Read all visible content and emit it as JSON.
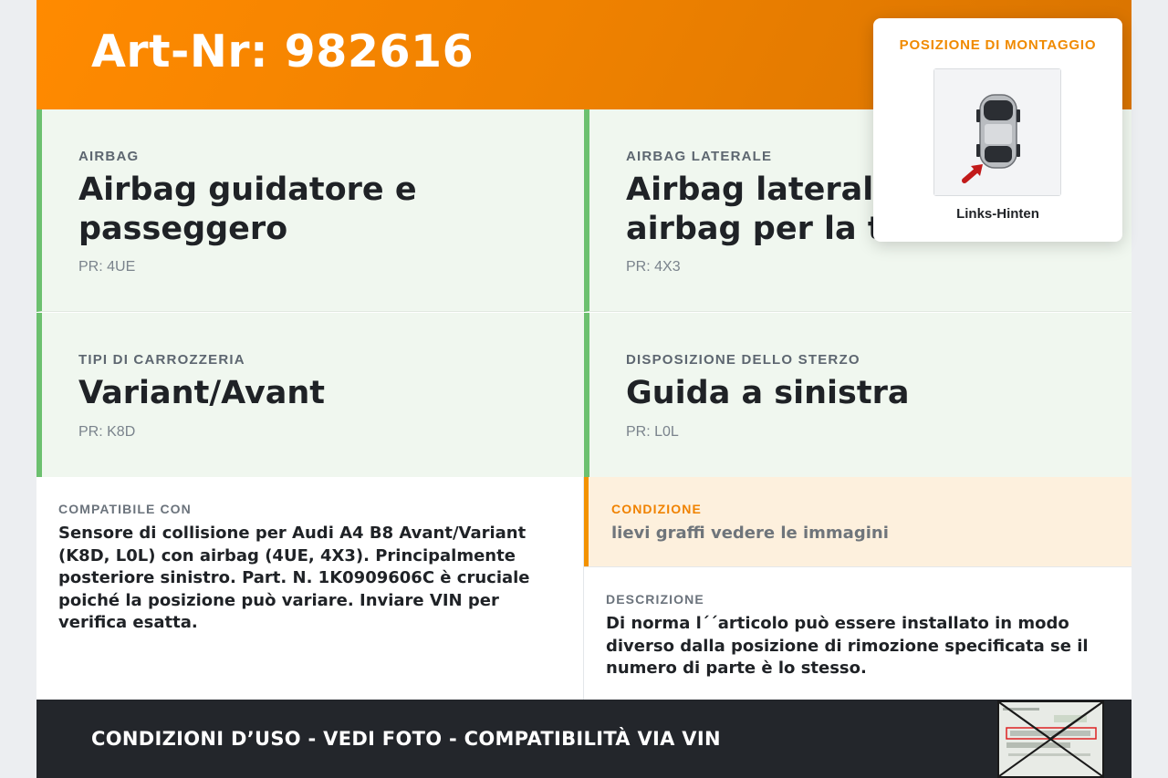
{
  "header": {
    "art_nr": "Art-Nr: 982616"
  },
  "cards": [
    {
      "label": "AIRBAG",
      "value": "Airbag guidatore e passeggero",
      "pr": "PR: 4UE"
    },
    {
      "label": "AIRBAG LATERALE",
      "value": "Airbag laterale anteriore e airbag per la testa",
      "pr": "PR: 4X3"
    },
    {
      "label": "TIPI DI CARROZZERIA",
      "value": "Variant/Avant",
      "pr": "PR: K8D"
    },
    {
      "label": "DISPOSIZIONE DELLO STERZO",
      "value": "Guida a sinistra",
      "pr": "PR: L0L"
    }
  ],
  "compat": {
    "label": "COMPATIBILE CON",
    "text": "Sensore di collisione per Audi A4 B8 Avant/Variant (K8D, L0L) con airbag (4UE, 4X3). Principalmente posteriore sinistro. Part. N. 1K0909606C è cruciale poiché la posizione può variare. Inviare VIN per verifica esatta."
  },
  "condition": {
    "label": "CONDIZIONE",
    "text": "lievi graffi vedere le immagini"
  },
  "description": {
    "label": "DESCRIZIONE",
    "text": "Di norma l´´articolo può essere installato in modo diverso dalla posizione di rimozione specificata se il numero di parte è lo stesso."
  },
  "footer": {
    "text": "CONDIZIONI D’USO - VEDI FOTO - COMPATIBILITÀ VIA VIN"
  },
  "popup": {
    "title": "POSIZIONE DI MONTAGGIO",
    "caption": "Links-Hinten"
  },
  "colors": {
    "accent": "#f39200",
    "card_border": "#6cc06f",
    "footer_bg": "#23262b"
  }
}
